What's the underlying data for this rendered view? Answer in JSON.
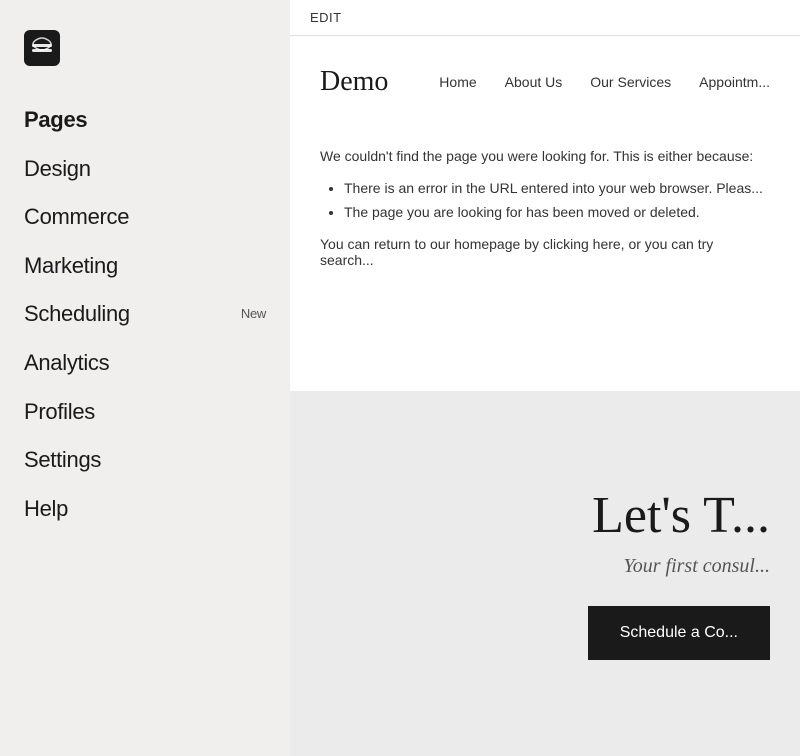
{
  "sidebar": {
    "logo_icon": "squarespace-logo",
    "nav_items": [
      {
        "label": "Pages",
        "badge": "",
        "active": true
      },
      {
        "label": "Design",
        "badge": ""
      },
      {
        "label": "Commerce",
        "badge": ""
      },
      {
        "label": "Marketing",
        "badge": ""
      },
      {
        "label": "Scheduling",
        "badge": "New"
      },
      {
        "label": "Analytics",
        "badge": ""
      },
      {
        "label": "Profiles",
        "badge": ""
      },
      {
        "label": "Settings",
        "badge": ""
      },
      {
        "label": "Help",
        "badge": ""
      }
    ]
  },
  "edit_bar": {
    "label": "EDIT"
  },
  "preview": {
    "site_title": "Demo",
    "nav_links": [
      "Home",
      "About Us",
      "Our Services",
      "Appointm..."
    ],
    "error": {
      "intro": "We couldn't find the page you were looking for. This is either because:",
      "bullets": [
        "There is an error in the URL entered into your web browser. Pleas...",
        "The page you are looking for has been moved or deleted."
      ],
      "footer": "You can return to our homepage by clicking here, or you can try search..."
    },
    "cta": {
      "heading": "Let's T...",
      "subtext": "Your first consul...",
      "button_label": "Schedule a Co..."
    }
  }
}
